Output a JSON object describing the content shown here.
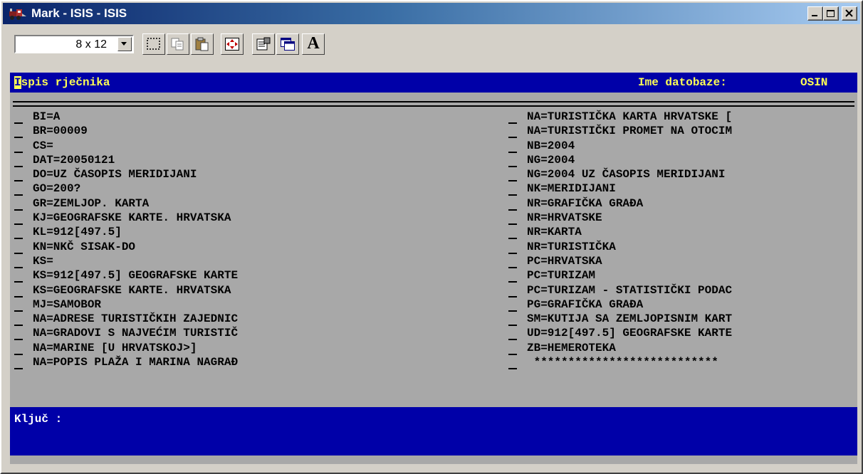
{
  "window": {
    "title": "Mark - ISIS - ISIS",
    "controls": {
      "minimize_icon": "minimize-icon",
      "maximize_icon": "maximize-icon",
      "close_icon": "close-icon"
    }
  },
  "toolbar": {
    "font_size": "8 x 12",
    "tools": [
      "mark-icon",
      "copy-icon",
      "paste-icon",
      "fullscreen-icon",
      "properties-icon",
      "background-icon",
      "font-icon"
    ],
    "font_button_label": "A"
  },
  "console": {
    "header_title_first": "I",
    "header_title_rest": "spis rječnika",
    "database_label": "Ime datobaze:",
    "database_name": "OSIN",
    "left_entries": [
      "BI=A",
      "BR=00009",
      "CS=",
      "DAT=20050121",
      "DO=UZ ČASOPIS MERIDIJANI",
      "GO=200?",
      "GR=ZEMLJOP. KARTA",
      "KJ=GEOGRAFSKE KARTE. HRVATSKA",
      "KL=912[497.5]",
      "KN=NKČ SISAK-DO",
      "KS=",
      "KS=912[497.5] GEOGRAFSKE KARTE",
      "KS=GEOGRAFSKE KARTE. HRVATSKA",
      "MJ=SAMOBOR",
      "NA=ADRESE TURISTIČKIH ZAJEDNIC",
      "NA=GRADOVI S NAJVEĆIM TURISTIČ",
      "NA=MARINE [U HRVATSKOJ>]",
      "NA=POPIS PLAŽA I MARINA NAGRAĐ"
    ],
    "right_entries": [
      "NA=TURISTIČKA KARTA HRVATSKE [",
      "NA=TURISTIČKI PROMET NA OTOCIM",
      "NB=2004",
      "NG=2004",
      "NG=2004 UZ ČASOPIS MERIDIJANI",
      "NK=MERIDIJANI",
      "NR=GRAFIČKA GRAĐA",
      "NR=HRVATSKE",
      "NR=KARTA",
      "NR=TURISTIČKA",
      "PC=HRVATSKA",
      "PC=TURIZAM",
      "PC=TURIZAM - STATISTIČKI PODAC",
      "PG=GRAFIČKA GRAĐA",
      "SM=KUTIJA SA ZEMLJOPISNIM KART",
      "UD=912[497.5] GEOGRAFSKE KARTE",
      "ZB=HEMEROTEKA",
      " ***************************"
    ],
    "key_prompt": "Ključ :"
  },
  "colors": {
    "console_blue": "#0000a8",
    "console_grey": "#a8a8a8",
    "header_yellow": "#ffff55",
    "titlebar_start": "#0a246a",
    "titlebar_end": "#a6caf0"
  }
}
